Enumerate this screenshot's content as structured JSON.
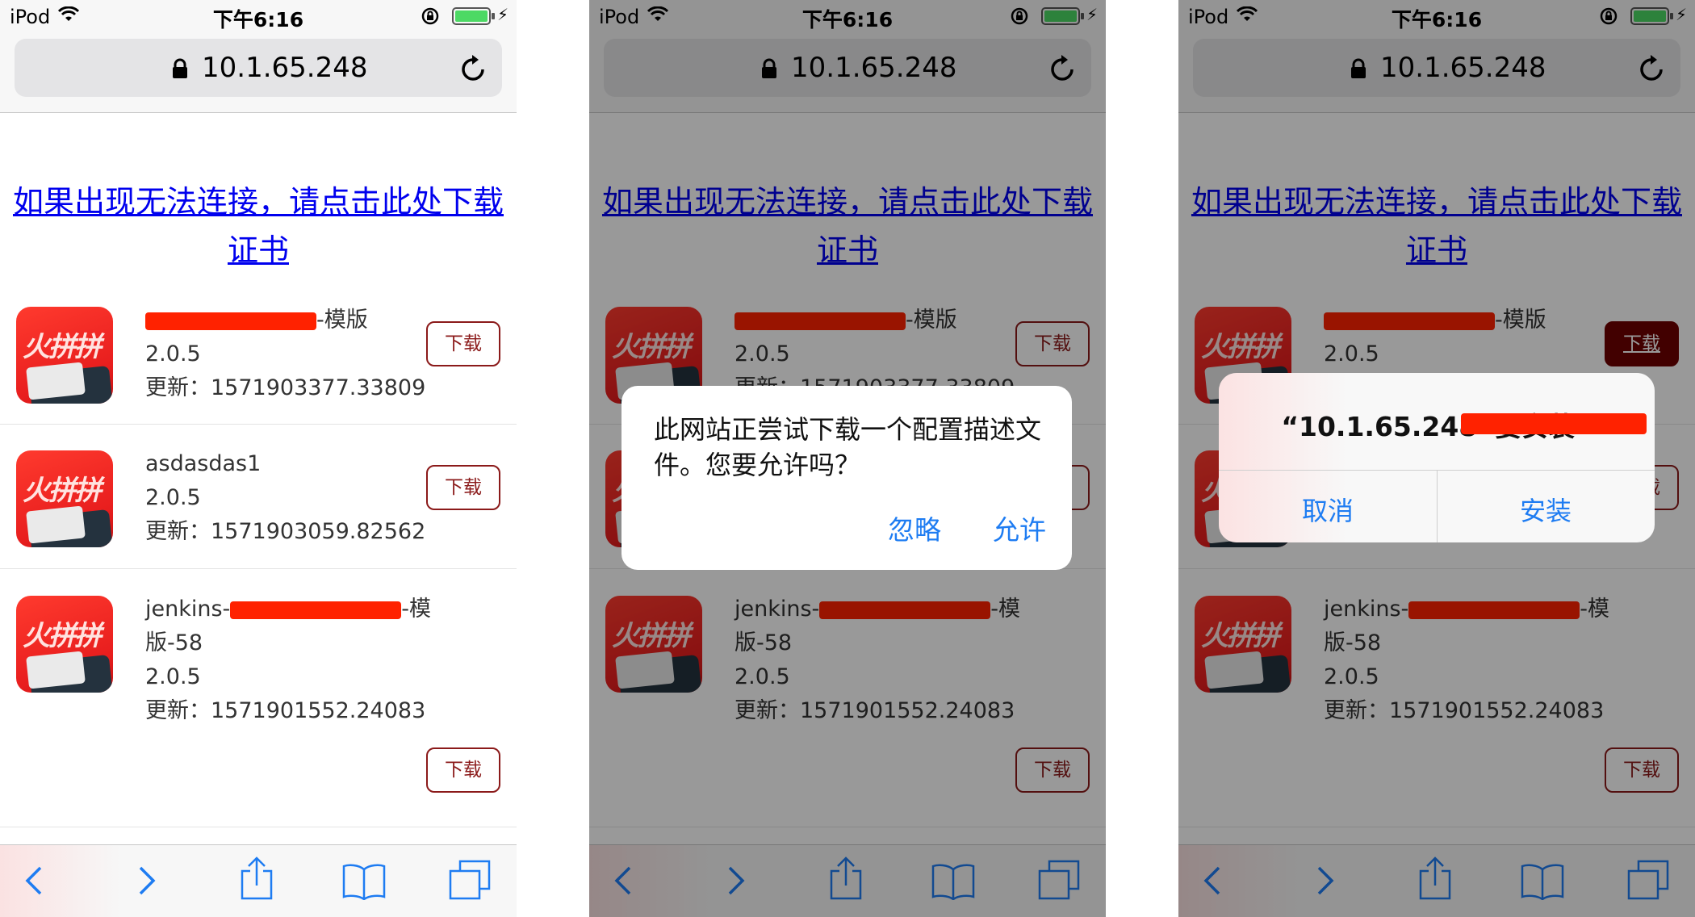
{
  "status": {
    "carrier": "iPod",
    "time": "下午6:16"
  },
  "browser": {
    "url": "10.1.65.248"
  },
  "page": {
    "cert_link": "如果出现无法连接，请点击此处下载证书",
    "apps": [
      {
        "name_suffix": "-模版",
        "version": "2.0.5",
        "updated": "更新：1571903377.33809",
        "download": "下载"
      },
      {
        "name": "asdasdas1",
        "version": "2.0.5",
        "updated": "更新：1571903059.82562",
        "download": "下载"
      },
      {
        "name_prefix": "jenkins-",
        "name_suffix": "-模",
        "name_cont": "版-58",
        "version": "2.0.5",
        "updated": "更新：1571901552.24083",
        "download": "下载"
      }
    ],
    "logo_text": "火拼拼"
  },
  "dialog_profile": {
    "message": "此网站正尝试下载一个配置描述文件。您要允许吗？",
    "ignore": "忽略",
    "allow": "允许"
  },
  "dialog_install": {
    "title": "“10.1.65.248”要安装“",
    "cancel": "取消",
    "install": "安装"
  },
  "colors": {
    "link": "#0000ee",
    "accent_blue": "#1e7cf2",
    "download_border": "#8b1a1a",
    "redaction": "#ff2200"
  },
  "icons": [
    "wifi-icon",
    "lock-icon",
    "battery-icon",
    "reload-icon",
    "back-icon",
    "forward-icon",
    "share-icon",
    "bookmarks-icon",
    "tabs-icon"
  ]
}
